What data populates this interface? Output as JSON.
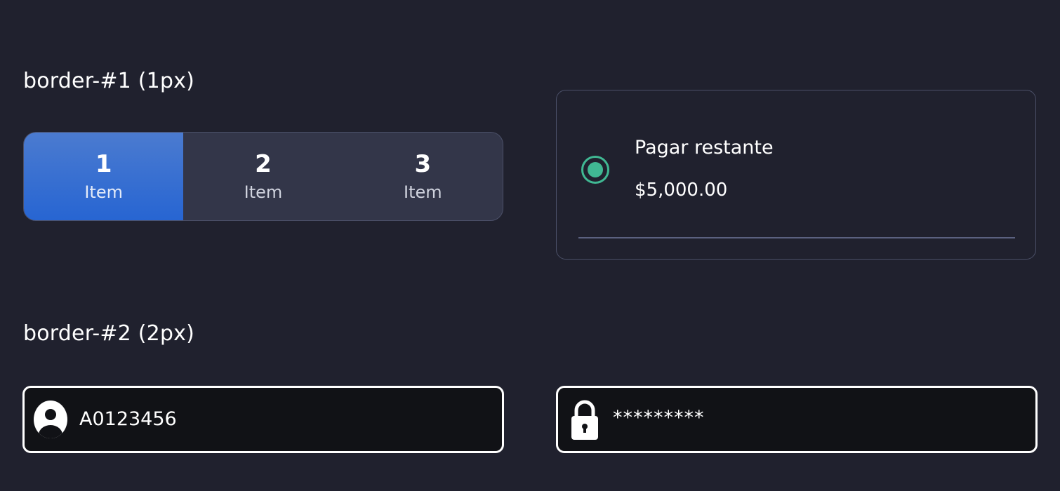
{
  "sections": {
    "border1_title": "border-#1 (1px)",
    "border2_title": "border-#2 (2px)"
  },
  "segmented": {
    "items": [
      {
        "number": "1",
        "label": "Item",
        "active": true
      },
      {
        "number": "2",
        "label": "Item",
        "active": false
      },
      {
        "number": "3",
        "label": "Item",
        "active": false
      }
    ]
  },
  "payment_option": {
    "title": "Pagar restante",
    "amount": "$5,000.00",
    "selected": true
  },
  "inputs": {
    "username": {
      "value": "A0123456",
      "icon": "user-icon"
    },
    "password": {
      "value": "*********",
      "icon": "lock-icon"
    }
  },
  "colors": {
    "background": "#20212e",
    "active_segment": "#2765d2",
    "radio_accent": "#40b893",
    "input_border": "#ffffff",
    "input_background": "#111216"
  }
}
